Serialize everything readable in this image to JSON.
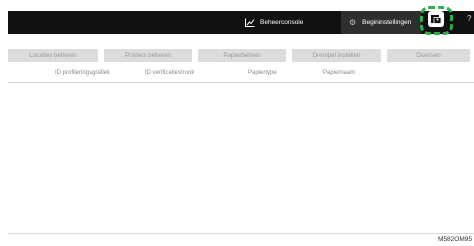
{
  "header": {
    "admin_console_label": "Beheerconsole",
    "initial_settings_label": "Begininstellingen",
    "user_button_icon": "user-card-icon",
    "colors": {
      "bar": "#111111",
      "active_item": "#2e2e2e",
      "highlight": "#2bb24c"
    }
  },
  "tabs": [
    {
      "label": "Locaties beheren"
    },
    {
      "label": "Printers beheren"
    },
    {
      "label": "Papierbeheer"
    },
    {
      "label": "Drempel instellen"
    },
    {
      "label": "Diversen"
    }
  ],
  "table": {
    "columns": [
      "ID profileringsgrafiek",
      "ID verificatiestrook",
      "Papiertype",
      "Papiernaam"
    ]
  },
  "figure_id": "M582OM95"
}
